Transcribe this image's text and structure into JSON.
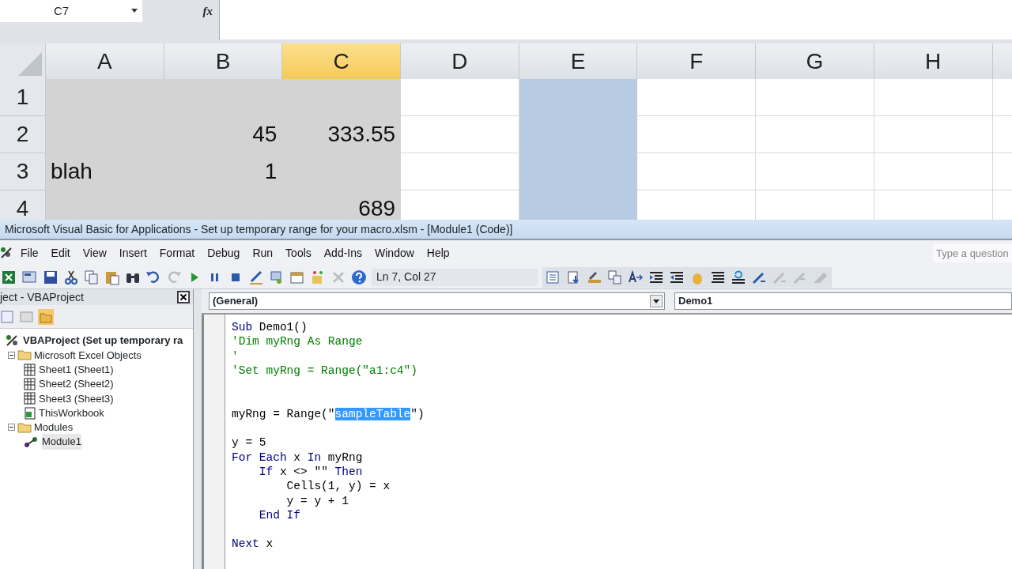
{
  "excel": {
    "name_box": "C7",
    "fx_label": "fx",
    "columns": [
      {
        "label": "A",
        "selected": false,
        "highlighted": false
      },
      {
        "label": "B",
        "selected": false,
        "highlighted": false
      },
      {
        "label": "C",
        "selected": true,
        "highlighted": false
      },
      {
        "label": "D",
        "selected": false,
        "highlighted": false
      },
      {
        "label": "E",
        "selected": false,
        "highlighted": true
      },
      {
        "label": "F",
        "selected": false,
        "highlighted": false
      },
      {
        "label": "G",
        "selected": false,
        "highlighted": false
      },
      {
        "label": "H",
        "selected": false,
        "highlighted": false
      }
    ],
    "rows": [
      {
        "label": "1",
        "cells": [
          {
            "selected": true
          },
          {
            "selected": true
          },
          {
            "selected": true
          },
          {
            "selected": false
          },
          {
            "selected": false
          },
          {
            "selected": false
          },
          {
            "selected": false
          },
          {
            "selected": false
          }
        ]
      },
      {
        "label": "2",
        "cells": [
          {
            "selected": true
          },
          {
            "text": "45",
            "kind": "number",
            "selected": true
          },
          {
            "text": "333.55",
            "kind": "number",
            "selected": true
          },
          {
            "selected": false
          },
          {
            "selected": false
          },
          {
            "selected": false
          },
          {
            "selected": false
          },
          {
            "selected": false
          }
        ]
      },
      {
        "label": "3",
        "cells": [
          {
            "text": "blah",
            "kind": "text",
            "selected": true
          },
          {
            "text": "1",
            "kind": "number",
            "selected": true
          },
          {
            "selected": true
          },
          {
            "selected": false
          },
          {
            "selected": false
          },
          {
            "selected": false
          },
          {
            "selected": false
          },
          {
            "selected": false
          }
        ]
      },
      {
        "label": "4",
        "cells": [
          {
            "selected": true
          },
          {
            "selected": true
          },
          {
            "text": "689",
            "kind": "number",
            "selected": true
          },
          {
            "selected": false
          },
          {
            "selected": false
          },
          {
            "selected": false
          },
          {
            "selected": false
          },
          {
            "selected": false
          }
        ]
      }
    ]
  },
  "vba": {
    "title": "Microsoft Visual Basic for Applications - Set up temporary range for your macro.xlsm - [Module1 (Code)]",
    "menu": [
      "File",
      "Edit",
      "View",
      "Insert",
      "Format",
      "Debug",
      "Run",
      "Tools",
      "Add-Ins",
      "Window",
      "Help"
    ],
    "help_search": {
      "placeholder": "Type a question"
    },
    "position": "Ln 7, Col 27",
    "project": {
      "title": "ject - VBAProject",
      "tree": [
        {
          "label": "VBAProject (Set up temporary ra",
          "kind": "project",
          "children": [
            {
              "label": "Microsoft Excel Objects",
              "kind": "folder",
              "expanded": true,
              "children": [
                {
                  "label": "Sheet1 (Sheet1)",
                  "kind": "sheet"
                },
                {
                  "label": "Sheet2 (Sheet2)",
                  "kind": "sheet"
                },
                {
                  "label": "Sheet3 (Sheet3)",
                  "kind": "sheet"
                },
                {
                  "label": "ThisWorkbook",
                  "kind": "workbook"
                }
              ]
            },
            {
              "label": "Modules",
              "kind": "folder",
              "expanded": true,
              "children": [
                {
                  "label": "Module1",
                  "kind": "module",
                  "selected": true
                }
              ]
            }
          ]
        }
      ]
    },
    "object_combo": "(General)",
    "procedure_combo": "Demo1",
    "code": [
      {
        "kind": "code",
        "parts": [
          {
            "text": "Sub",
            "kind": "keyword"
          },
          {
            "text": " Demo1()",
            "kind": "plain"
          }
        ]
      },
      {
        "kind": "comment",
        "text": "'Dim myRng As Range"
      },
      {
        "kind": "comment",
        "text": "'"
      },
      {
        "kind": "comment",
        "text": "'Set myRng = Range(\"a1:c4\")"
      },
      {
        "kind": "blank"
      },
      {
        "kind": "blank"
      },
      {
        "kind": "code",
        "parts": [
          {
            "text": "myRng = Range(\"",
            "kind": "plain"
          },
          {
            "text": "sampleTable",
            "kind": "selection"
          },
          {
            "text": "\")",
            "kind": "plain"
          }
        ]
      },
      {
        "kind": "blank"
      },
      {
        "kind": "code",
        "parts": [
          {
            "text": "y = 5",
            "kind": "plain"
          }
        ]
      },
      {
        "kind": "code",
        "parts": [
          {
            "text": "For Each",
            "kind": "keyword"
          },
          {
            "text": " x ",
            "kind": "plain"
          },
          {
            "text": "In",
            "kind": "keyword"
          },
          {
            "text": " myRng",
            "kind": "plain"
          }
        ]
      },
      {
        "kind": "code",
        "parts": [
          {
            "text": "    If",
            "kind": "keyword"
          },
          {
            "text": " x <> \"\" ",
            "kind": "plain"
          },
          {
            "text": "Then",
            "kind": "keyword"
          }
        ]
      },
      {
        "kind": "code",
        "parts": [
          {
            "text": "        Cells(1, y) = x",
            "kind": "plain"
          }
        ]
      },
      {
        "kind": "code",
        "parts": [
          {
            "text": "        y = y + 1",
            "kind": "plain"
          }
        ]
      },
      {
        "kind": "code",
        "parts": [
          {
            "text": "    End If",
            "kind": "keyword"
          }
        ]
      },
      {
        "kind": "blank"
      },
      {
        "kind": "code",
        "parts": [
          {
            "text": "Next",
            "kind": "keyword"
          },
          {
            "text": " x",
            "kind": "plain"
          }
        ]
      }
    ]
  }
}
